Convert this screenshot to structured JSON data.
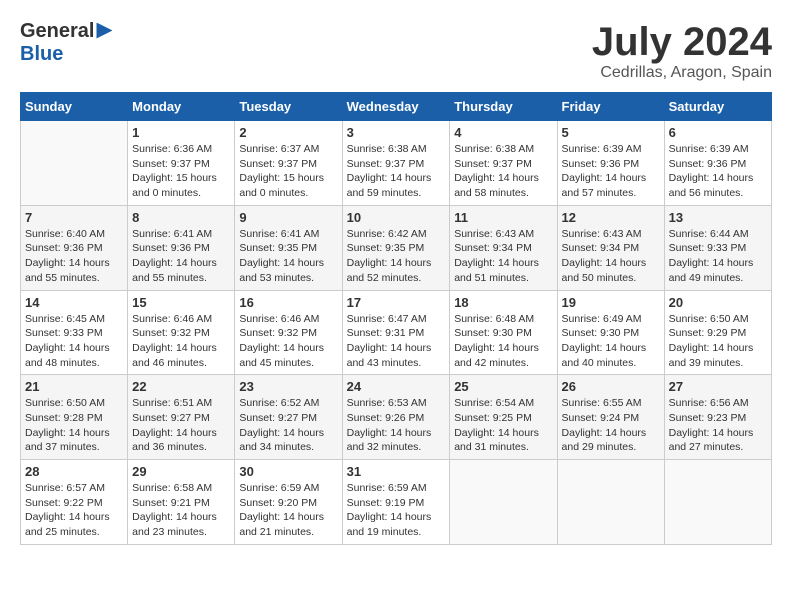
{
  "header": {
    "logo_general": "General",
    "logo_blue": "Blue",
    "month_year": "July 2024",
    "location": "Cedrillas, Aragon, Spain"
  },
  "weekdays": [
    "Sunday",
    "Monday",
    "Tuesday",
    "Wednesday",
    "Thursday",
    "Friday",
    "Saturday"
  ],
  "weeks": [
    [
      {
        "day": "",
        "sunrise": "",
        "sunset": "",
        "daylight": ""
      },
      {
        "day": "1",
        "sunrise": "Sunrise: 6:36 AM",
        "sunset": "Sunset: 9:37 PM",
        "daylight": "Daylight: 15 hours and 0 minutes."
      },
      {
        "day": "2",
        "sunrise": "Sunrise: 6:37 AM",
        "sunset": "Sunset: 9:37 PM",
        "daylight": "Daylight: 15 hours and 0 minutes."
      },
      {
        "day": "3",
        "sunrise": "Sunrise: 6:38 AM",
        "sunset": "Sunset: 9:37 PM",
        "daylight": "Daylight: 14 hours and 59 minutes."
      },
      {
        "day": "4",
        "sunrise": "Sunrise: 6:38 AM",
        "sunset": "Sunset: 9:37 PM",
        "daylight": "Daylight: 14 hours and 58 minutes."
      },
      {
        "day": "5",
        "sunrise": "Sunrise: 6:39 AM",
        "sunset": "Sunset: 9:36 PM",
        "daylight": "Daylight: 14 hours and 57 minutes."
      },
      {
        "day": "6",
        "sunrise": "Sunrise: 6:39 AM",
        "sunset": "Sunset: 9:36 PM",
        "daylight": "Daylight: 14 hours and 56 minutes."
      }
    ],
    [
      {
        "day": "7",
        "sunrise": "Sunrise: 6:40 AM",
        "sunset": "Sunset: 9:36 PM",
        "daylight": "Daylight: 14 hours and 55 minutes."
      },
      {
        "day": "8",
        "sunrise": "Sunrise: 6:41 AM",
        "sunset": "Sunset: 9:36 PM",
        "daylight": "Daylight: 14 hours and 55 minutes."
      },
      {
        "day": "9",
        "sunrise": "Sunrise: 6:41 AM",
        "sunset": "Sunset: 9:35 PM",
        "daylight": "Daylight: 14 hours and 53 minutes."
      },
      {
        "day": "10",
        "sunrise": "Sunrise: 6:42 AM",
        "sunset": "Sunset: 9:35 PM",
        "daylight": "Daylight: 14 hours and 52 minutes."
      },
      {
        "day": "11",
        "sunrise": "Sunrise: 6:43 AM",
        "sunset": "Sunset: 9:34 PM",
        "daylight": "Daylight: 14 hours and 51 minutes."
      },
      {
        "day": "12",
        "sunrise": "Sunrise: 6:43 AM",
        "sunset": "Sunset: 9:34 PM",
        "daylight": "Daylight: 14 hours and 50 minutes."
      },
      {
        "day": "13",
        "sunrise": "Sunrise: 6:44 AM",
        "sunset": "Sunset: 9:33 PM",
        "daylight": "Daylight: 14 hours and 49 minutes."
      }
    ],
    [
      {
        "day": "14",
        "sunrise": "Sunrise: 6:45 AM",
        "sunset": "Sunset: 9:33 PM",
        "daylight": "Daylight: 14 hours and 48 minutes."
      },
      {
        "day": "15",
        "sunrise": "Sunrise: 6:46 AM",
        "sunset": "Sunset: 9:32 PM",
        "daylight": "Daylight: 14 hours and 46 minutes."
      },
      {
        "day": "16",
        "sunrise": "Sunrise: 6:46 AM",
        "sunset": "Sunset: 9:32 PM",
        "daylight": "Daylight: 14 hours and 45 minutes."
      },
      {
        "day": "17",
        "sunrise": "Sunrise: 6:47 AM",
        "sunset": "Sunset: 9:31 PM",
        "daylight": "Daylight: 14 hours and 43 minutes."
      },
      {
        "day": "18",
        "sunrise": "Sunrise: 6:48 AM",
        "sunset": "Sunset: 9:30 PM",
        "daylight": "Daylight: 14 hours and 42 minutes."
      },
      {
        "day": "19",
        "sunrise": "Sunrise: 6:49 AM",
        "sunset": "Sunset: 9:30 PM",
        "daylight": "Daylight: 14 hours and 40 minutes."
      },
      {
        "day": "20",
        "sunrise": "Sunrise: 6:50 AM",
        "sunset": "Sunset: 9:29 PM",
        "daylight": "Daylight: 14 hours and 39 minutes."
      }
    ],
    [
      {
        "day": "21",
        "sunrise": "Sunrise: 6:50 AM",
        "sunset": "Sunset: 9:28 PM",
        "daylight": "Daylight: 14 hours and 37 minutes."
      },
      {
        "day": "22",
        "sunrise": "Sunrise: 6:51 AM",
        "sunset": "Sunset: 9:27 PM",
        "daylight": "Daylight: 14 hours and 36 minutes."
      },
      {
        "day": "23",
        "sunrise": "Sunrise: 6:52 AM",
        "sunset": "Sunset: 9:27 PM",
        "daylight": "Daylight: 14 hours and 34 minutes."
      },
      {
        "day": "24",
        "sunrise": "Sunrise: 6:53 AM",
        "sunset": "Sunset: 9:26 PM",
        "daylight": "Daylight: 14 hours and 32 minutes."
      },
      {
        "day": "25",
        "sunrise": "Sunrise: 6:54 AM",
        "sunset": "Sunset: 9:25 PM",
        "daylight": "Daylight: 14 hours and 31 minutes."
      },
      {
        "day": "26",
        "sunrise": "Sunrise: 6:55 AM",
        "sunset": "Sunset: 9:24 PM",
        "daylight": "Daylight: 14 hours and 29 minutes."
      },
      {
        "day": "27",
        "sunrise": "Sunrise: 6:56 AM",
        "sunset": "Sunset: 9:23 PM",
        "daylight": "Daylight: 14 hours and 27 minutes."
      }
    ],
    [
      {
        "day": "28",
        "sunrise": "Sunrise: 6:57 AM",
        "sunset": "Sunset: 9:22 PM",
        "daylight": "Daylight: 14 hours and 25 minutes."
      },
      {
        "day": "29",
        "sunrise": "Sunrise: 6:58 AM",
        "sunset": "Sunset: 9:21 PM",
        "daylight": "Daylight: 14 hours and 23 minutes."
      },
      {
        "day": "30",
        "sunrise": "Sunrise: 6:59 AM",
        "sunset": "Sunset: 9:20 PM",
        "daylight": "Daylight: 14 hours and 21 minutes."
      },
      {
        "day": "31",
        "sunrise": "Sunrise: 6:59 AM",
        "sunset": "Sunset: 9:19 PM",
        "daylight": "Daylight: 14 hours and 19 minutes."
      },
      {
        "day": "",
        "sunrise": "",
        "sunset": "",
        "daylight": ""
      },
      {
        "day": "",
        "sunrise": "",
        "sunset": "",
        "daylight": ""
      },
      {
        "day": "",
        "sunrise": "",
        "sunset": "",
        "daylight": ""
      }
    ]
  ]
}
